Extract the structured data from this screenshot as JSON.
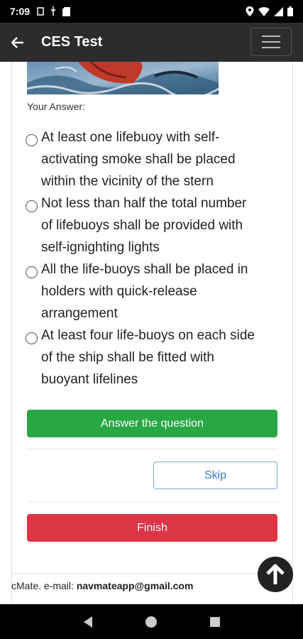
{
  "status_bar": {
    "time": "7:09",
    "left_icons": [
      "sim-icon",
      "usb-icon",
      "storage-icon"
    ],
    "right_icons": [
      "location-icon",
      "wifi-icon",
      "signal-icon",
      "battery-icon"
    ]
  },
  "app_bar": {
    "title": "CES Test",
    "back_icon": "arrow-left-icon",
    "menu_icon": "hamburger-icon"
  },
  "question": {
    "answer_label": "Your Answer:",
    "options": [
      {
        "lines": [
          "At least one lifebuoy with self-",
          "activating smoke shall be placed",
          "within the vicinity of the stern"
        ]
      },
      {
        "lines": [
          "Not less than half the total number",
          "of lifebuoys shall be provided with",
          "self-ignighting lights"
        ]
      },
      {
        "lines": [
          "All the life-buoys shall be placed in",
          "holders with quick-release",
          "arrangement"
        ]
      },
      {
        "lines": [
          "At least four life-buoys on each side",
          "of the ship shall be fitted with",
          "buoyant lifelines"
        ]
      }
    ]
  },
  "buttons": {
    "answer": "Answer the question",
    "skip": "Skip",
    "finish": "Finish"
  },
  "footer": {
    "prefix": "cMate. e-mail: ",
    "email": "navmateapp@gmail.com"
  },
  "colors": {
    "answer_button": "#28a745",
    "finish_button": "#dc3545",
    "skip_border": "#7ea7d8",
    "app_bar": "#2c2c2c"
  }
}
